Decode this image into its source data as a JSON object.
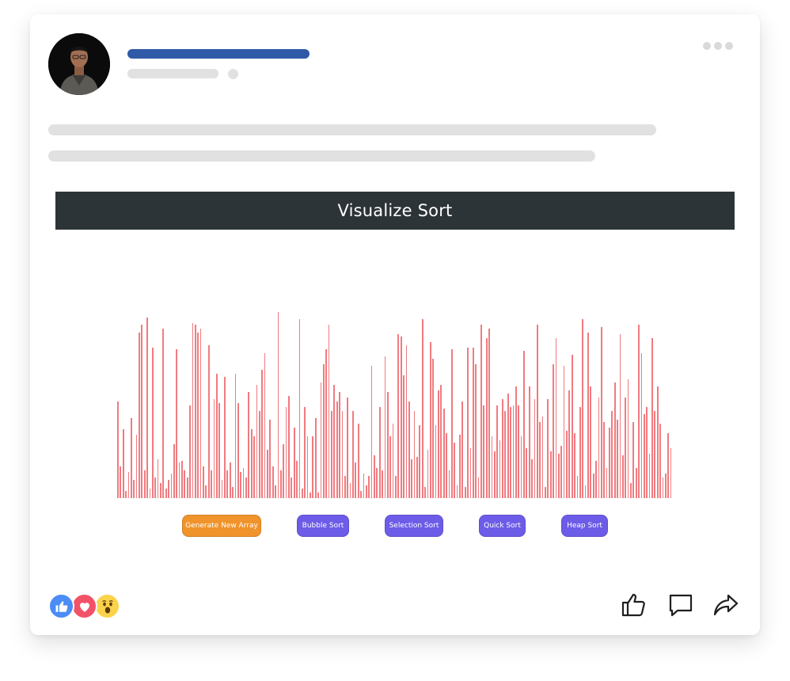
{
  "post": {
    "avatar_icon": "person-photo",
    "more_icon": "more-dots-icon"
  },
  "visualizer": {
    "title": "Visualize Sort",
    "bar_color": "#f07b80",
    "header_color": "#2d3437",
    "array_values": [
      52,
      17,
      37,
      4,
      14,
      43,
      10,
      34,
      89,
      93,
      15,
      97,
      5,
      81,
      11,
      21,
      8,
      91,
      5,
      10,
      13,
      29,
      80,
      19,
      20,
      15,
      11,
      50,
      94,
      93,
      89,
      91,
      17,
      7,
      82,
      15,
      53,
      67,
      51,
      10,
      65,
      15,
      19,
      6,
      67,
      51,
      14,
      16,
      11,
      57,
      37,
      33,
      61,
      47,
      69,
      78,
      26,
      42,
      17,
      7,
      100,
      15,
      29,
      49,
      55,
      11,
      38,
      20,
      96,
      5,
      49,
      33,
      3,
      33,
      43,
      3,
      62,
      72,
      80,
      93,
      47,
      61,
      52,
      57,
      47,
      12,
      54,
      8,
      47,
      19,
      40,
      4,
      13,
      7,
      12,
      71,
      23,
      16,
      49,
      15,
      76,
      57,
      33,
      40,
      12,
      88,
      87,
      66,
      82,
      52,
      21,
      47,
      22,
      39,
      96,
      6,
      26,
      84,
      75,
      39,
      58,
      61,
      48,
      35,
      15,
      80,
      30,
      7,
      34,
      52,
      6,
      81,
      27,
      81,
      72,
      11,
      93,
      50,
      86,
      91,
      33,
      25,
      50,
      31,
      53,
      47,
      56,
      49,
      50,
      60,
      50,
      33,
      79,
      27,
      60,
      21,
      53,
      93,
      41,
      44,
      6,
      53,
      25,
      72,
      86,
      24,
      28,
      71,
      36,
      58,
      77,
      35,
      12,
      49,
      96,
      7,
      89,
      60,
      13,
      20,
      54,
      92,
      41,
      16,
      38,
      47,
      62,
      42,
      88,
      23,
      54,
      64,
      8,
      41,
      16,
      93,
      78,
      45,
      49,
      24,
      86,
      47,
      60,
      40,
      11,
      13,
      35,
      27
    ]
  },
  "buttons": [
    {
      "label": "Generate New Array",
      "color": "#f0932b"
    },
    {
      "label": "Bubble Sort",
      "color": "#6c5ce7"
    },
    {
      "label": "Selection Sort",
      "color": "#6c5ce7"
    },
    {
      "label": "Quick Sort",
      "color": "#6c5ce7"
    },
    {
      "label": "Heap Sort",
      "color": "#6c5ce7"
    }
  ],
  "reactions": [
    {
      "name": "like-reaction-icon",
      "color": "#4b8cf5"
    },
    {
      "name": "love-reaction-icon",
      "color": "#f25268"
    },
    {
      "name": "wow-reaction-icon",
      "color": "#fbd34b"
    }
  ],
  "actions": [
    {
      "name": "like-icon"
    },
    {
      "name": "comment-icon"
    },
    {
      "name": "share-icon"
    }
  ]
}
